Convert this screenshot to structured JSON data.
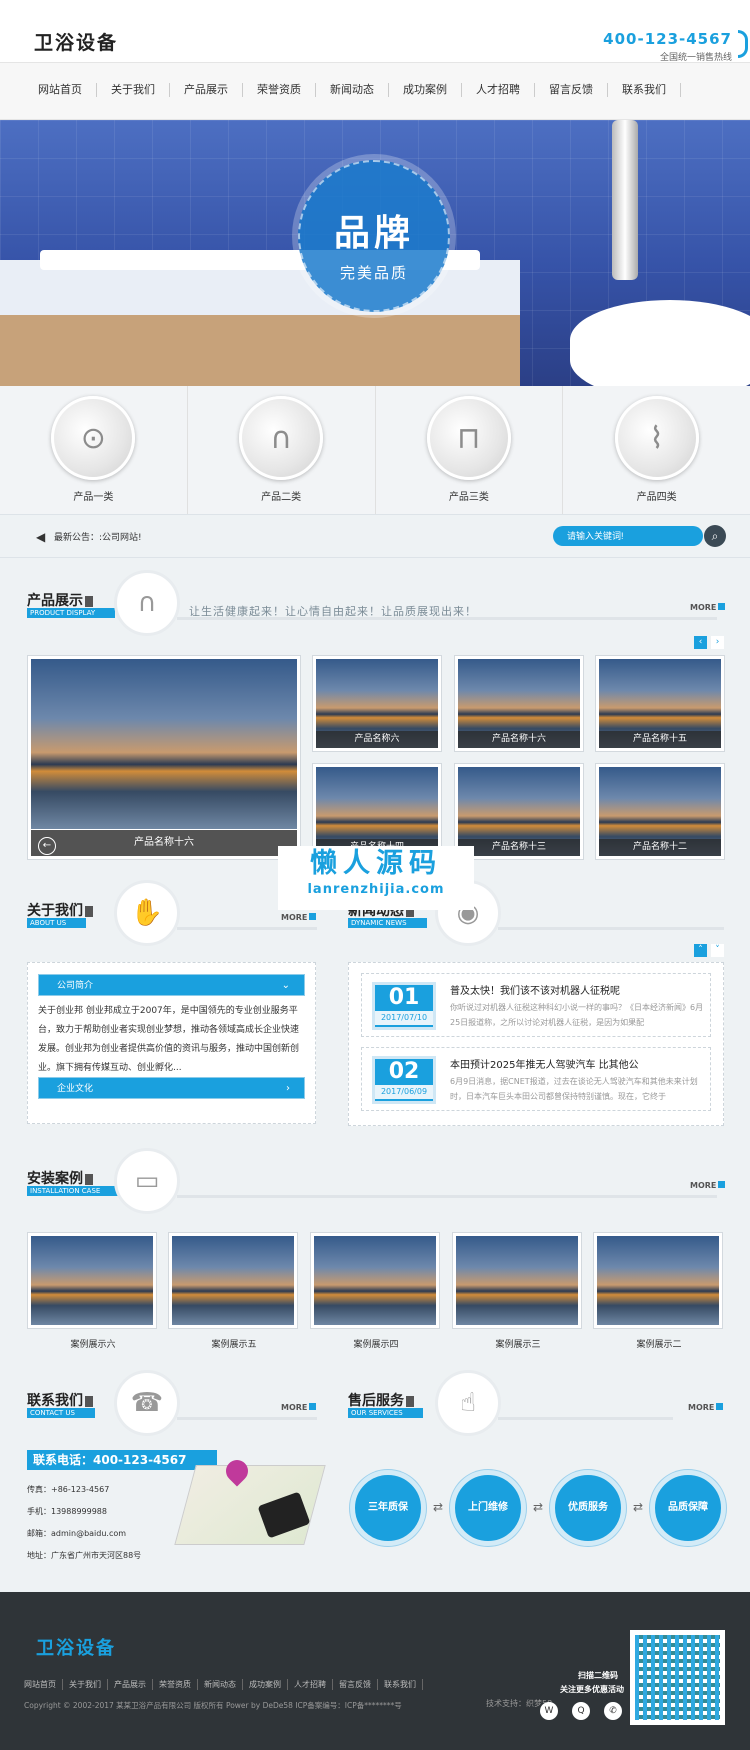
{
  "header": {
    "logo": "卫浴设备",
    "hotline": "400-123-4567",
    "hotline_sub": "全国统一销售热线"
  },
  "nav": [
    "网站首页",
    "关于我们",
    "产品展示",
    "荣誉资质",
    "新闻动态",
    "成功案例",
    "人才招聘",
    "留言反馈",
    "联系我们"
  ],
  "banner": {
    "title": "品牌",
    "subtitle": "完美品质"
  },
  "categories": [
    "产品一类",
    "产品二类",
    "产品三类",
    "产品四类"
  ],
  "announce": {
    "label": "最新公告：",
    "text": ":公司网站!"
  },
  "search": {
    "placeholder": "请输入关键词!"
  },
  "products_section": {
    "title": "产品展示",
    "en": "PRODUCT DISPLAY",
    "slogan": "让生活健康起来！让心情自由起来！让品质展现出来！",
    "more": "MORE",
    "big": "产品名称十六",
    "thumbs": [
      "产品名称六",
      "产品名称十六",
      "产品名称十五",
      "产品名称十四",
      "产品名称十三",
      "产品名称十二"
    ]
  },
  "watermark": {
    "cn": "懒人源码",
    "en": "lanrenzhijia.com"
  },
  "about": {
    "title": "关于我们",
    "en": "ABOUT US",
    "more": "MORE",
    "tab1": "公司简介",
    "text": "关于创业邦 创业邦成立于2007年，是中国领先的专业创业服务平台，致力于帮助创业者实现创业梦想，推动各领域高成长企业快速发展。创业邦为创业者提供高价值的资讯与服务，推动中国创新创业。旗下拥有传媒互动、创业孵化...",
    "tab2": "企业文化"
  },
  "news": {
    "title": "新闻动态",
    "en": "DYNAMIC NEWS",
    "items": [
      {
        "day": "01",
        "date": "2017/07/10",
        "title": "普及太快！我们该不该对机器人征税呢",
        "desc": "你听说过对机器人征税这种科幻小说一样的事吗？《日本经济新闻》6月25日报道称，之所以讨论对机器人征税，是因为如果配"
      },
      {
        "day": "02",
        "date": "2017/06/09",
        "title": "本田预计2025年推无人驾驶汽车 比其他公",
        "desc": "6月9日消息，据CNET报道，过去在谈论无人驾驶汽车和其他未来计划时，日本汽车巨头本田公司都曾保持特别谨慎。现在，它终于"
      }
    ]
  },
  "cases": {
    "title": "安装案例",
    "en": "INSTALLATION CASE",
    "more": "MORE",
    "items": [
      "案例展示六",
      "案例展示五",
      "案例展示四",
      "案例展示三",
      "案例展示二"
    ]
  },
  "contact": {
    "title": "联系我们",
    "en": "CONTACT US",
    "more": "MORE",
    "tel_bar": "联系电话：400-123-4567",
    "fax": "传真：+86-123-4567",
    "mobile": "手机：13988999988",
    "email": "邮箱：admin@baidu.com",
    "address": "地址：广东省广州市天河区88号"
  },
  "service": {
    "title": "售后服务",
    "en": "OUR SERVICES",
    "more": "MORE",
    "items": [
      "三年质保",
      "上门维修",
      "优质服务",
      "品质保障"
    ]
  },
  "footer": {
    "logo": "卫浴设备",
    "nav": [
      "网站首页",
      "关于我们",
      "产品展示",
      "荣誉资质",
      "新闻动态",
      "成功案例",
      "人才招聘",
      "留言反馈",
      "联系我们"
    ],
    "copyright": "Copyright © 2002-2017 某某卫浴产品有限公司 版权所有 Power by DeDe58   ICP备案编号：ICP备********号",
    "tech": "技术支持：织梦58",
    "qr1": "扫描二维码",
    "qr2": "关注更多优惠活动"
  },
  "colors": {
    "accent": "#1aa0de",
    "footer": "#2f3438"
  }
}
